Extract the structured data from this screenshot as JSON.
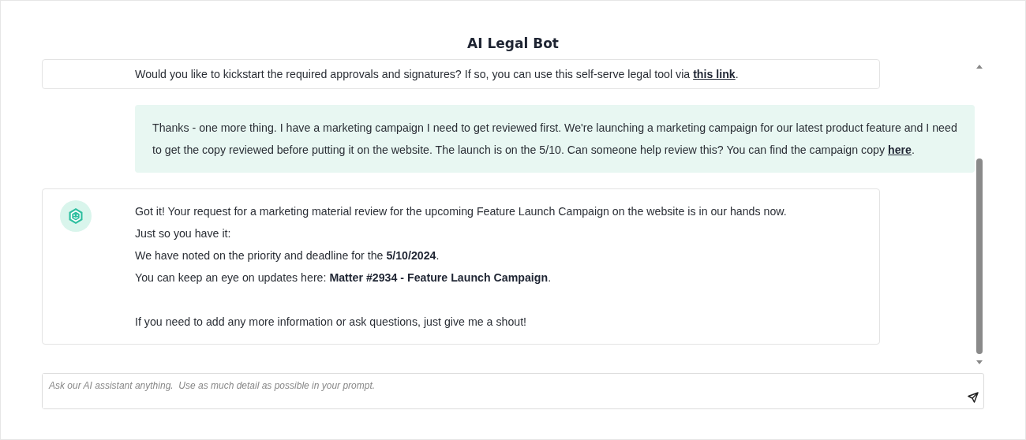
{
  "window": {
    "title": "AI Legal Bot"
  },
  "messages": [
    {
      "kind": "bot",
      "avatar": false,
      "blocks": [
        [
          [
            {
              "kind": "plain",
              "text": "Would you like to kickstart the required approvals and signatures? If so, you can use this self-serve legal tool via "
            },
            {
              "kind": "link",
              "text": "this link"
            },
            {
              "kind": "plain",
              "text": "."
            }
          ]
        ]
      ]
    },
    {
      "kind": "user",
      "blocks": [
        [
          [
            {
              "kind": "plain",
              "text": "Thanks - one more thing. I have a marketing campaign I need to get reviewed first. We're launching a marketing campaign for our latest product feature and I need to get the copy reviewed before putting it on the website. The launch is on the 5/10. Can someone help review this? You can find the campaign copy "
            },
            {
              "kind": "link",
              "text": "here"
            },
            {
              "kind": "plain",
              "text": "."
            }
          ]
        ]
      ]
    },
    {
      "kind": "bot",
      "avatar": true,
      "blocks": [
        [
          [
            {
              "kind": "plain",
              "text": "Got it! Your request for a marketing material review for the upcoming Feature Launch Campaign on the website is in our hands now. Just so you have it:"
            }
          ],
          [
            {
              "kind": "plain",
              "text": "We have noted on the priority and deadline for the "
            },
            {
              "kind": "bold",
              "text": "5/10/2024"
            },
            {
              "kind": "plain",
              "text": "."
            }
          ],
          [
            {
              "kind": "plain",
              "text": "You can keep an eye on updates here: "
            },
            {
              "kind": "bold",
              "text": "Matter #2934 - Feature Launch Campaign"
            },
            {
              "kind": "plain",
              "text": "."
            }
          ]
        ],
        [
          [
            {
              "kind": "plain",
              "text": "If you need to add any more information or ask questions, just give me a shout!"
            }
          ]
        ]
      ]
    }
  ],
  "composer": {
    "placeholder": "Ask our AI assistant anything.  Use as much detail as possible in your prompt."
  }
}
